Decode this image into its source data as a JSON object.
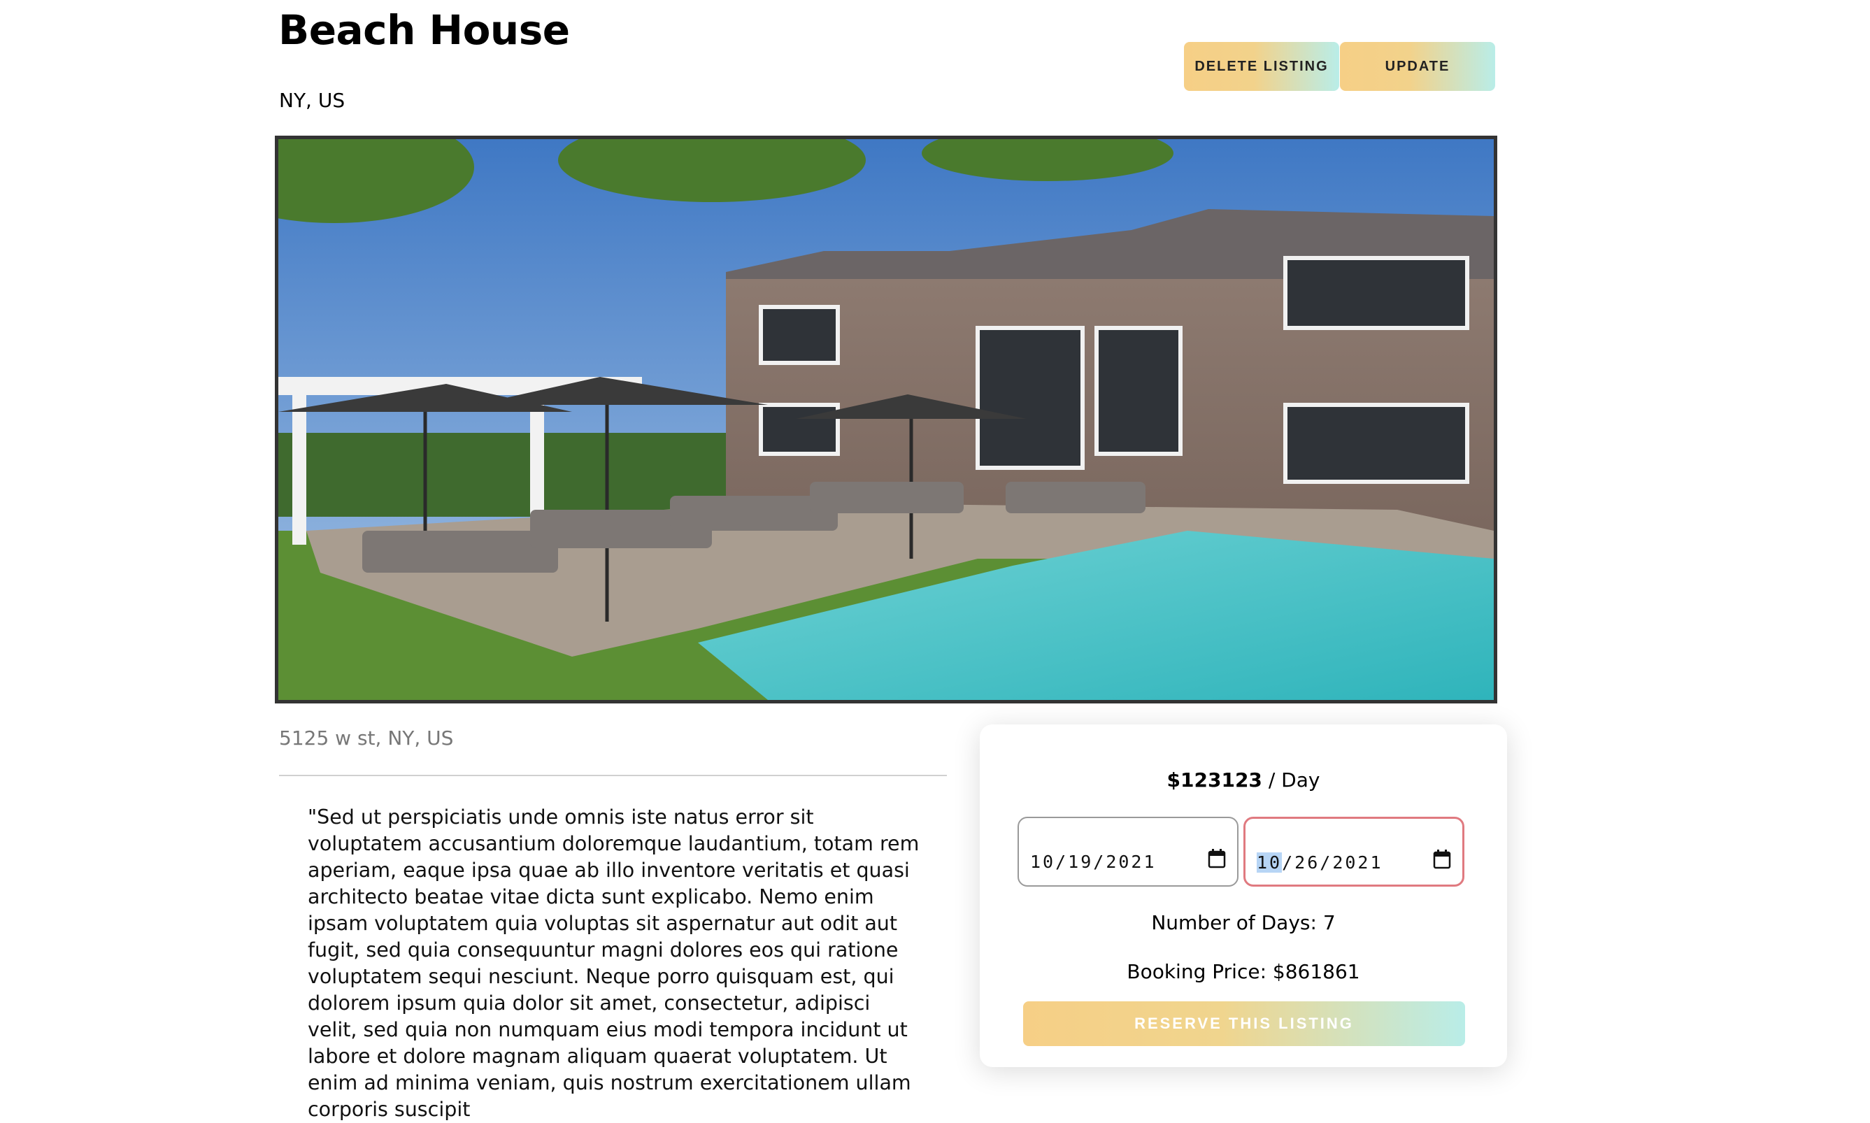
{
  "listing": {
    "title": "Beach House",
    "location": "NY, US",
    "address": "5125 w st, NY, US",
    "description": "\"Sed ut perspiciatis unde omnis iste natus error sit voluptatem accusantium doloremque laudantium, totam rem aperiam, eaque ipsa quae ab illo inventore veritatis et quasi architecto beatae vitae dicta sunt explicabo. Nemo enim ipsam voluptatem quia voluptas sit aspernatur aut odit aut fugit, sed quia consequuntur magni dolores eos qui ratione voluptatem sequi nesciunt. Neque porro quisquam est, qui dolorem ipsum quia dolor sit amet, consectetur, adipisci velit, sed quia non numquam eius modi tempora incidunt ut labore et dolore magnam aliquam quaerat voluptatem. Ut enim ad minima veniam, quis nostrum exercitationem ullam corporis suscipit"
  },
  "actions": {
    "delete_label": "DELETE LISTING",
    "update_label": "UPDATE"
  },
  "booking": {
    "price": "$123123",
    "price_unit": " / Day",
    "start_date": {
      "month": "10",
      "rest": "/19/2021"
    },
    "end_date": {
      "month": "10",
      "rest": "/26/2021"
    },
    "days_text": "Number of Days: 7",
    "price_text": "Booking Price: $861861",
    "reserve_label": "RESERVE THIS LISTING"
  },
  "colors": {
    "accent_start": "#f6cf86",
    "accent_end": "#b9ede8",
    "focus_border": "#e07a80"
  },
  "icons": {
    "calendar": "calendar-icon"
  }
}
